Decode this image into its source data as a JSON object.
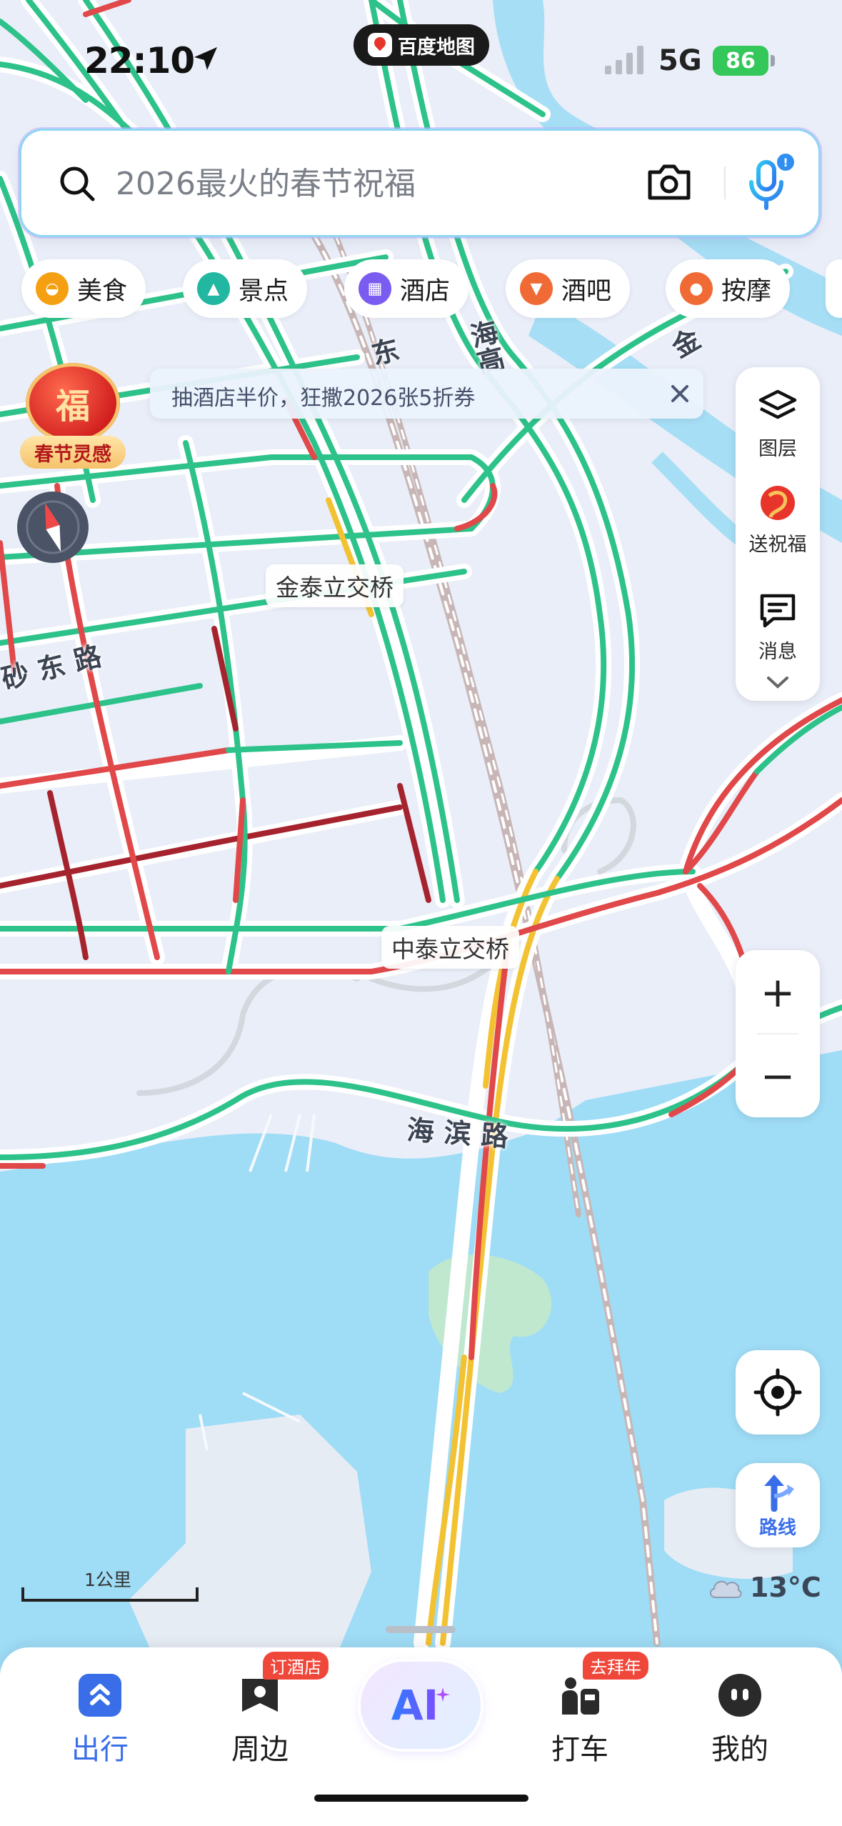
{
  "status_bar": {
    "time": "22:10",
    "app_name": "百度地图",
    "network": "5G",
    "battery": "86"
  },
  "search": {
    "placeholder": "2026最火的春节祝福",
    "camera_icon": "camera-icon",
    "mic_icon": "microphone-icon"
  },
  "categories": [
    {
      "label": "美食",
      "icon": "food-icon",
      "color": "#f5a012"
    },
    {
      "label": "景点",
      "icon": "scenic-icon",
      "color": "#21b7a1"
    },
    {
      "label": "酒店",
      "icon": "hotel-icon",
      "color": "#7a5cf0"
    },
    {
      "label": "酒吧",
      "icon": "bar-icon",
      "color": "#f06a35"
    },
    {
      "label": "按摩",
      "icon": "massage-icon",
      "color": "#f06a35"
    }
  ],
  "promo": {
    "text": "抽酒店半价，狂撒2026张5折券"
  },
  "festival": {
    "char": "福",
    "label": "春节灵感"
  },
  "tools": {
    "layers": "图层",
    "greeting": "送祝福",
    "messages": "消息"
  },
  "map": {
    "labels": {
      "jintai": "金泰立交桥",
      "zhongtai": "中泰立交桥"
    },
    "roads": {
      "shadong": "砂东路",
      "haibin": "海滨路",
      "haigao": "海高",
      "dong": "东",
      "jin": "金"
    }
  },
  "scale": {
    "label": "1公里"
  },
  "weather": {
    "temp": "13°C",
    "icon": "cloud-icon"
  },
  "colors": {
    "smooth": "#2ec28b",
    "slow": "#f2c232",
    "congested": "#e0484a",
    "severe": "#a5232d",
    "water": "#9ddcf5",
    "accent": "#3a6ee8"
  },
  "nav": {
    "items": [
      {
        "label": "出行",
        "active": true
      },
      {
        "label": "周边",
        "badge": "订酒店"
      },
      {
        "label": "AI"
      },
      {
        "label": "打车",
        "badge": "去拜年"
      },
      {
        "label": "我的"
      }
    ]
  }
}
